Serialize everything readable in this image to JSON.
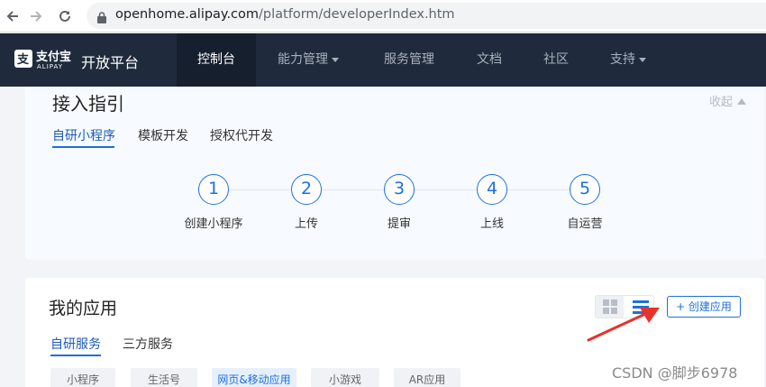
{
  "browser": {
    "url_domain": "openhome.alipay.com",
    "url_path": "/platform/developerIndex.htm"
  },
  "header": {
    "logo_zh": "支付宝",
    "logo_en": "ALIPAY",
    "platform": "开放平台",
    "nav": [
      {
        "label": "控制台",
        "active": true,
        "dropdown": false
      },
      {
        "label": "能力管理",
        "active": false,
        "dropdown": true
      },
      {
        "label": "服务管理",
        "active": false,
        "dropdown": false
      },
      {
        "label": "文档",
        "active": false,
        "dropdown": false
      },
      {
        "label": "社区",
        "active": false,
        "dropdown": false
      },
      {
        "label": "支持",
        "active": false,
        "dropdown": true
      }
    ]
  },
  "guide": {
    "title": "接入指引",
    "collapse_label": "收起",
    "tabs": [
      "自研小程序",
      "模板开发",
      "授权代开发"
    ],
    "active_tab": "自研小程序",
    "steps": [
      {
        "num": "1",
        "label": "创建小程序"
      },
      {
        "num": "2",
        "label": "上传"
      },
      {
        "num": "3",
        "label": "提审"
      },
      {
        "num": "4",
        "label": "上线"
      },
      {
        "num": "5",
        "label": "自运营"
      }
    ]
  },
  "apps": {
    "title": "我的应用",
    "create_label": "+ 创建应用",
    "tabs": [
      "自研服务",
      "三方服务"
    ],
    "active_tab": "自研服务",
    "categories": [
      "小程序",
      "生活号",
      "网页&移动应用",
      "小游戏",
      "AR应用"
    ],
    "active_category": "网页&移动应用"
  },
  "watermark": "CSDN @脚步6978",
  "colors": {
    "accent": "#1d6fe4",
    "nav_bg": "#1f2a3c",
    "annotation_arrow": "#e8322b"
  }
}
